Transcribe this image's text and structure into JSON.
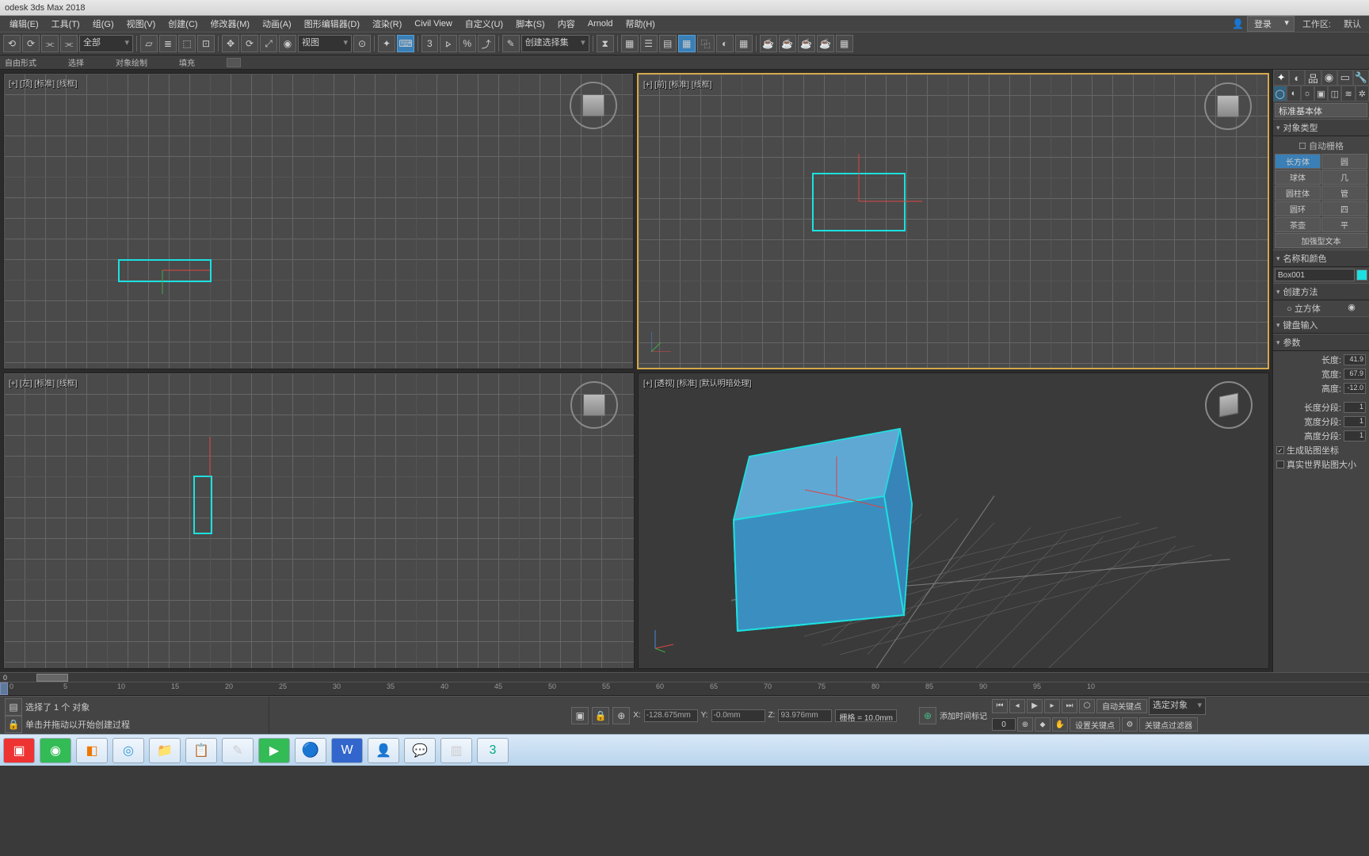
{
  "title": "odesk 3ds Max 2018",
  "menu": [
    "编辑(E)",
    "工具(T)",
    "组(G)",
    "视图(V)",
    "创建(C)",
    "修改器(M)",
    "动画(A)",
    "图形编辑器(D)",
    "渲染(R)",
    "Civil View",
    "自定义(U)",
    "脚本(S)",
    "内容",
    "Arnold",
    "帮助(H)"
  ],
  "login": {
    "label": "登录",
    "workspace": "工作区:",
    "default": "默认"
  },
  "toolbar": {
    "sel_all": "全部",
    "view": "视图",
    "named_set": "创建选择集"
  },
  "ribbon": [
    "自由形式",
    "选择",
    "对象绘制",
    "填充"
  ],
  "viewports": {
    "tl": "[+] [顶] [标准] [线框]",
    "tr": "[+] [前] [标准] [线框]",
    "bl": "[+] [左] [标准] [线框]",
    "br": "[+] [透视] [标准] [默认明暗处理]"
  },
  "panel": {
    "subcat": "标准基本体",
    "roll_objtype": "对象类型",
    "autogrid": "自动栅格",
    "objs": [
      "长方体",
      "圆",
      "球体",
      "几",
      "圆柱体",
      "管",
      "圆环",
      "四",
      "茶壶",
      "平",
      "加强型文本"
    ],
    "roll_name": "名称和颜色",
    "objname": "Box001",
    "roll_method": "创建方法",
    "method_cube": "立方体",
    "roll_keyboard": "键盘输入",
    "roll_params": "参数",
    "p_len": "长度:",
    "p_len_v": "41.9",
    "p_wid": "宽度:",
    "p_wid_v": "67.9",
    "p_hei": "高度:",
    "p_hei_v": "-12.0",
    "p_lseg": "长度分段:",
    "p_lseg_v": "1",
    "p_wseg": "宽度分段:",
    "p_wseg_v": "1",
    "p_hseg": "高度分段:",
    "p_hseg_v": "1",
    "gen_map": "生成贴图坐标",
    "real_map": "真实世界贴图大小"
  },
  "track_frame": "0",
  "status_lines": {
    "sel": "选择了 1 个 对象",
    "hint": "单击并拖动以开始创建过程"
  },
  "coords": {
    "x": "-128.675mm",
    "y": "-0.0mm",
    "z": "93.976mm",
    "grid": "栅格 = 10.0mm"
  },
  "add_time_tag": "添加时间标记",
  "playback": {
    "auto_key": "自动关键点",
    "sel_obj": "选定对象",
    "set_key": "设置关键点",
    "key_filter": "关键点过滤器",
    "frame": "0"
  },
  "timeline_ticks": [
    "0",
    "5",
    "10",
    "15",
    "20",
    "25",
    "30",
    "35",
    "40",
    "45",
    "50",
    "55",
    "60",
    "65",
    "70",
    "75",
    "80",
    "85",
    "90",
    "95",
    "10"
  ]
}
